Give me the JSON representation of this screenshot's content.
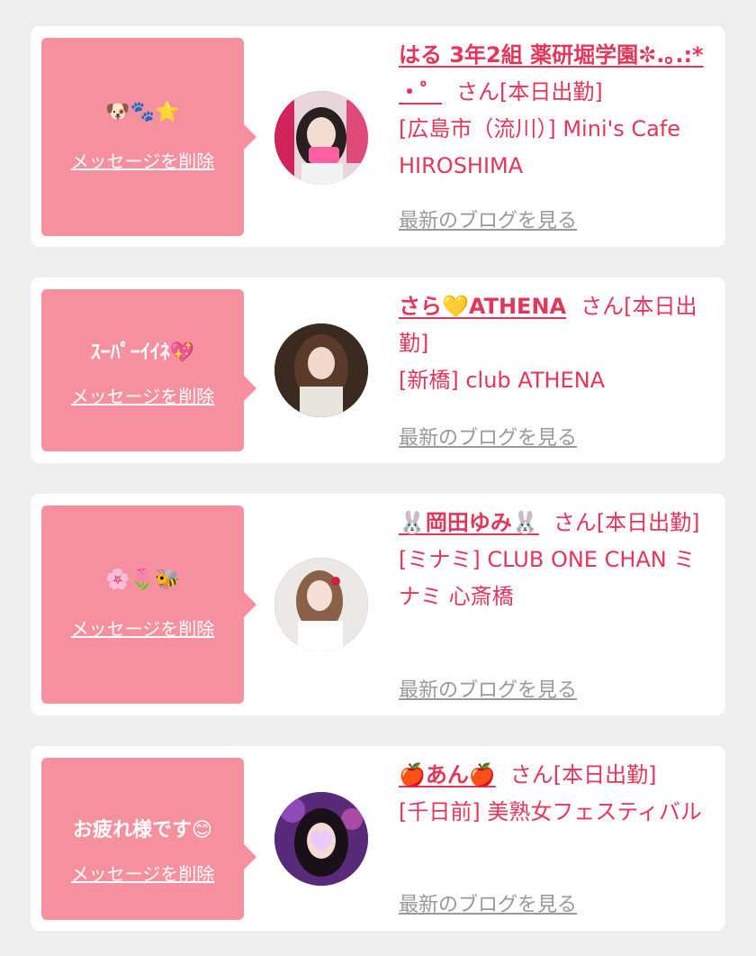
{
  "cards": [
    {
      "message": "🐶🐾⭐",
      "delete_label": "メッセージを削除",
      "name": "はる 3年2組 薬研堀学園✼.｡.:* ・゜",
      "suffix": "さん[本日出勤]",
      "shop": "[広島市（流川）] Mini's Cafe HIROSHIMA",
      "blog_label": "最新のブログを見る"
    },
    {
      "message": "ｽｰﾊﾟｰｲｲﾈ💖",
      "delete_label": "メッセージを削除",
      "name": "さら💛ATHENA",
      "suffix": "さん[本日出勤]",
      "shop": "[新橋] club ATHENA",
      "blog_label": "最新のブログを見る"
    },
    {
      "message": "🌸🌷🐝",
      "delete_label": "メッセージを削除",
      "name": "🐰岡田ゆみ🐰",
      "suffix": "さん[本日出勤]",
      "shop": "[ミナミ] CLUB ONE CHAN ミナミ 心斎橋",
      "blog_label": "最新のブログを見る"
    },
    {
      "message": "お疲れ様です😊",
      "delete_label": "メッセージを削除",
      "name": "🍎あん🍎",
      "suffix": "さん[本日出勤]",
      "shop": "[千日前] 美熟女フェスティバル",
      "blog_label": "最新のブログを見る"
    }
  ]
}
